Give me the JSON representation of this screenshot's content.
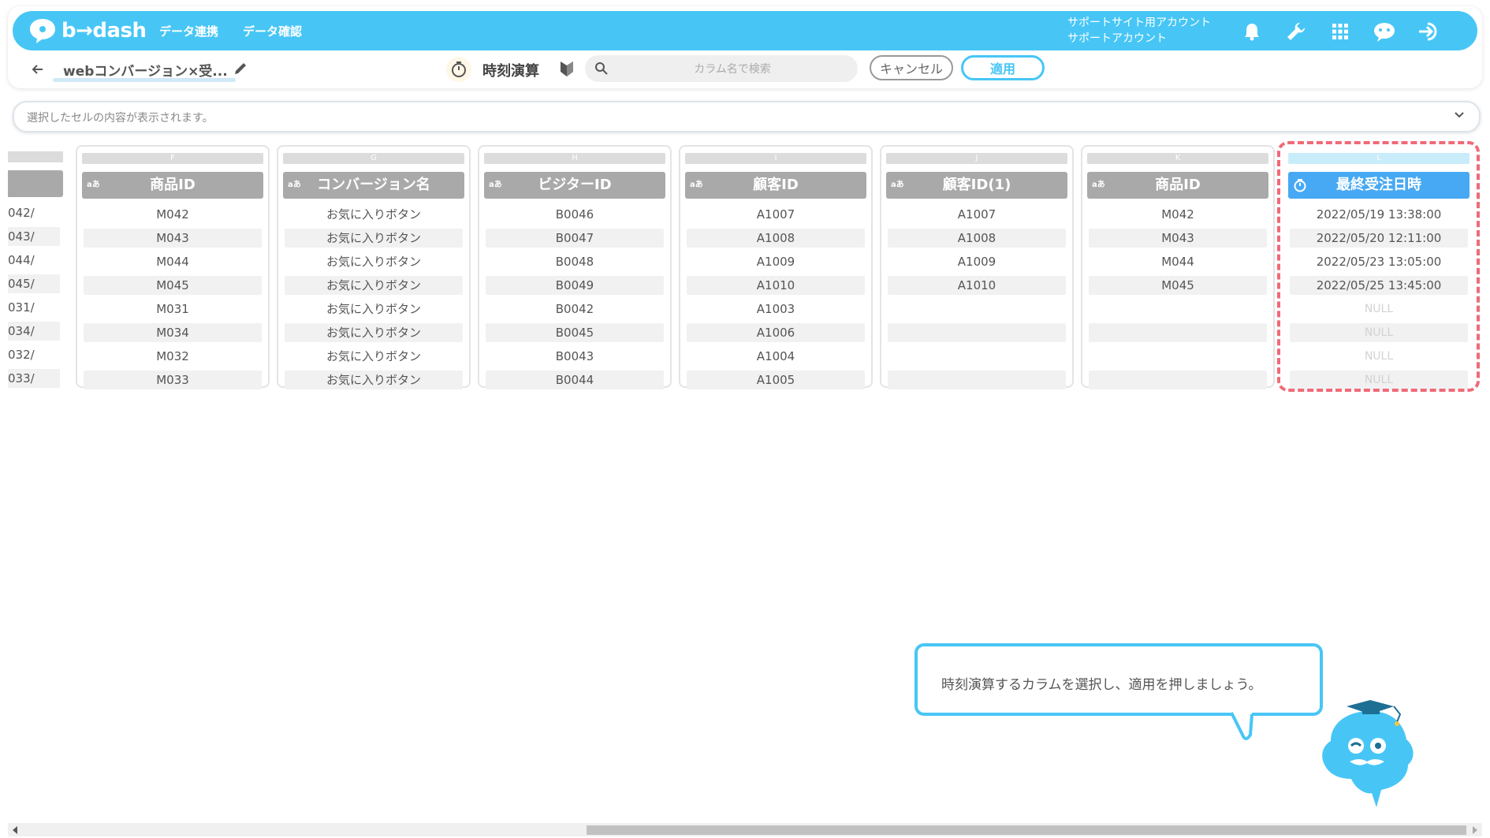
{
  "app": {
    "logo_text": "b→dash",
    "nav": [
      "データ連携",
      "データ確認"
    ],
    "account_line1": "サポートサイト用アカウント",
    "account_line2": "サポートアカウント",
    "icons": [
      "bell-icon",
      "wrench-icon",
      "grid-icon",
      "chat-robot-icon",
      "logout-icon"
    ]
  },
  "toolbar": {
    "file_name": "webコンバージョン×受...",
    "operation_label": "時刻演算",
    "search_placeholder": "カラム名で検索",
    "cancel_label": "キャンセル",
    "apply_label": "適用"
  },
  "cell_bar": {
    "placeholder": "選択したセルの内容が表示されます。"
  },
  "partial_column": {
    "cells": [
      "042/",
      "043/",
      "044/",
      "045/",
      "031/",
      "034/",
      "032/",
      "033/"
    ]
  },
  "columns": [
    {
      "letter": "F",
      "type": "aあ",
      "name": "商品ID",
      "cells": [
        "M042",
        "M043",
        "M044",
        "M045",
        "M031",
        "M034",
        "M032",
        "M033"
      ]
    },
    {
      "letter": "G",
      "type": "aあ",
      "name": "コンバージョン名",
      "cells": [
        "お気に入りボタン",
        "お気に入りボタン",
        "お気に入りボタン",
        "お気に入りボタン",
        "お気に入りボタン",
        "お気に入りボタン",
        "お気に入りボタン",
        "お気に入りボタン"
      ]
    },
    {
      "letter": "H",
      "type": "aあ",
      "name": "ビジターID",
      "cells": [
        "B0046",
        "B0047",
        "B0048",
        "B0049",
        "B0042",
        "B0045",
        "B0043",
        "B0044"
      ]
    },
    {
      "letter": "I",
      "type": "aあ",
      "name": "顧客ID",
      "cells": [
        "A1007",
        "A1008",
        "A1009",
        "A1010",
        "A1003",
        "A1006",
        "A1004",
        "A1005"
      ]
    },
    {
      "letter": "J",
      "type": "aあ",
      "name": "顧客ID(1)",
      "cells": [
        "A1007",
        "A1008",
        "A1009",
        "A1010",
        "",
        "",
        "",
        ""
      ]
    },
    {
      "letter": "K",
      "type": "aあ",
      "name": "商品ID",
      "cells": [
        "M042",
        "M043",
        "M044",
        "M045",
        "",
        "",
        "",
        ""
      ]
    },
    {
      "letter": "L",
      "type": "clock",
      "name": "最終受注日時",
      "cells": [
        "2022/05/19 13:38:00",
        "2022/05/20 12:11:00",
        "2022/05/23 13:05:00",
        "2022/05/25 13:45:00",
        "NULL",
        "NULL",
        "NULL",
        "NULL"
      ],
      "selected": true
    }
  ],
  "guide": {
    "message": "時刻演算するカラムを選択し、適用を押しましょう。"
  },
  "colors": {
    "accent": "#47c6f6",
    "selected_header": "#47a9f3",
    "highlight": "#f06a78"
  }
}
